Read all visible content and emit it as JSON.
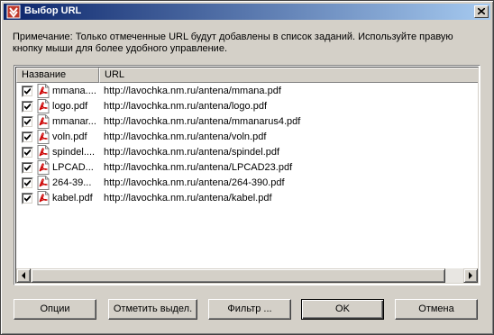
{
  "window": {
    "title": "Выбор URL",
    "close_symbol": "×"
  },
  "note": "Примечание: Только отмеченные URL будут добавлены в список заданий. Используйте правую кнопку мыши для более удобного управление.",
  "list": {
    "columns": [
      "Название",
      "URL"
    ],
    "rows": [
      {
        "name": "mmana....",
        "url": "http://lavochka.nm.ru/antena/mmana.pdf",
        "checked": true
      },
      {
        "name": "logo.pdf",
        "url": "http://lavochka.nm.ru/antena/logo.pdf",
        "checked": true
      },
      {
        "name": "mmanar...",
        "url": "http://lavochka.nm.ru/antena/mmanarus4.pdf",
        "checked": true
      },
      {
        "name": "voln.pdf",
        "url": "http://lavochka.nm.ru/antena/voln.pdf",
        "checked": true
      },
      {
        "name": "spindel....",
        "url": "http://lavochka.nm.ru/antena/spindel.pdf",
        "checked": true
      },
      {
        "name": "LPCAD...",
        "url": "http://lavochka.nm.ru/antena/LPCAD23.pdf",
        "checked": true
      },
      {
        "name": "264-39...",
        "url": "http://lavochka.nm.ru/antena/264-390.pdf",
        "checked": true
      },
      {
        "name": "kabel.pdf",
        "url": "http://lavochka.nm.ru/antena/kabel.pdf",
        "checked": true
      }
    ]
  },
  "buttons": {
    "options": "Опции",
    "mark_selected": "Отметить выдел.",
    "filter": "Фильтр ...",
    "ok": "OK",
    "cancel": "Отмена"
  },
  "icons": {
    "title": "app-icon",
    "row": "pdf-file-icon"
  },
  "colors": {
    "titlebar_start": "#0a246a",
    "titlebar_end": "#a6caf0",
    "face": "#d4d0c8",
    "pdf_red": "#cc0000"
  }
}
